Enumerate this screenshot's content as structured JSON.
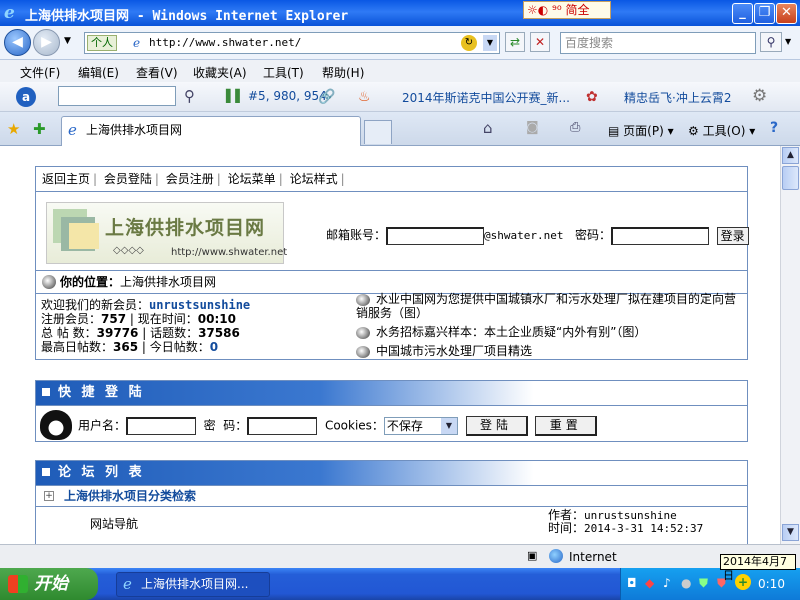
{
  "window": {
    "title": "上海供排水项目网 - Windows Internet Explorer",
    "ime": "简全"
  },
  "address": {
    "persona": "个人",
    "url": "http://www.shwater.net/",
    "search_placeholder": "百度搜索"
  },
  "menu": [
    "文件(F)",
    "编辑(E)",
    "查看(V)",
    "收藏夹(A)",
    "工具(T)",
    "帮助(H)"
  ],
  "toolbar": {
    "count": "#5, 980, 954",
    "link1": "2014年斯诺克中国公开赛_新...",
    "link2": "精忠岳飞·冲上云霄2"
  },
  "tab": {
    "title": "上海供排水项目网",
    "page": "页面(P)",
    "tools": "工具(O)"
  },
  "page": {
    "nav": [
      "返回主页",
      "会员登陆",
      "会员注册",
      "论坛菜单",
      "论坛样式"
    ],
    "logo": {
      "name": "上海供排水项目网",
      "url": "http://www.shwater.net"
    },
    "login": {
      "email_label": "邮箱账号：",
      "domain": "@shwater.net",
      "password_label": "密码：",
      "button": "登录"
    },
    "location": {
      "label": "你的位置：",
      "value": "上海供排水项目网"
    },
    "stats": {
      "welcome": "欢迎我们的新会员：",
      "newest": "unrustsunshine",
      "reg_label": "注册会员：",
      "reg": "757",
      "time_label": "现在时间：",
      "time": "00:10",
      "posts_label": "总 帖 数：",
      "posts": "39776",
      "topics_label": "话题数：",
      "topics": "37586",
      "maxday_label": "最高日帖数：",
      "maxday": "365",
      "today_label": "今日帖数：",
      "today": "0"
    },
    "news": [
      "水业中国网为您提供中国城镇水厂和污水处理厂拟在建项目的定向营销服务（图）",
      "水务招标嘉兴样本：本土企业质疑“内外有别”（图）",
      "中国城市污水处理厂项目精选"
    ],
    "quick": {
      "title": "快 捷 登 陆",
      "user_label": "用户名：",
      "pwd_label": "密  码：",
      "cookies_label": "Cookies：",
      "cookies_value": "不保存",
      "login_btn": "登陆",
      "reset_btn": "重置"
    },
    "forum": {
      "title": "论 坛 列 表",
      "category": "上海供排水项目分类检索",
      "board": "网站导航",
      "author_label": "作者：",
      "author": "unrustsunshine",
      "time_label": "时间：",
      "time": "2014-3-31 14:52:37"
    }
  },
  "status": {
    "zone": "Internet"
  },
  "taskbar": {
    "start": "开始",
    "item": "上海供排水项目网...",
    "clock": "0:10",
    "date_tip": "2014年4月7日"
  }
}
